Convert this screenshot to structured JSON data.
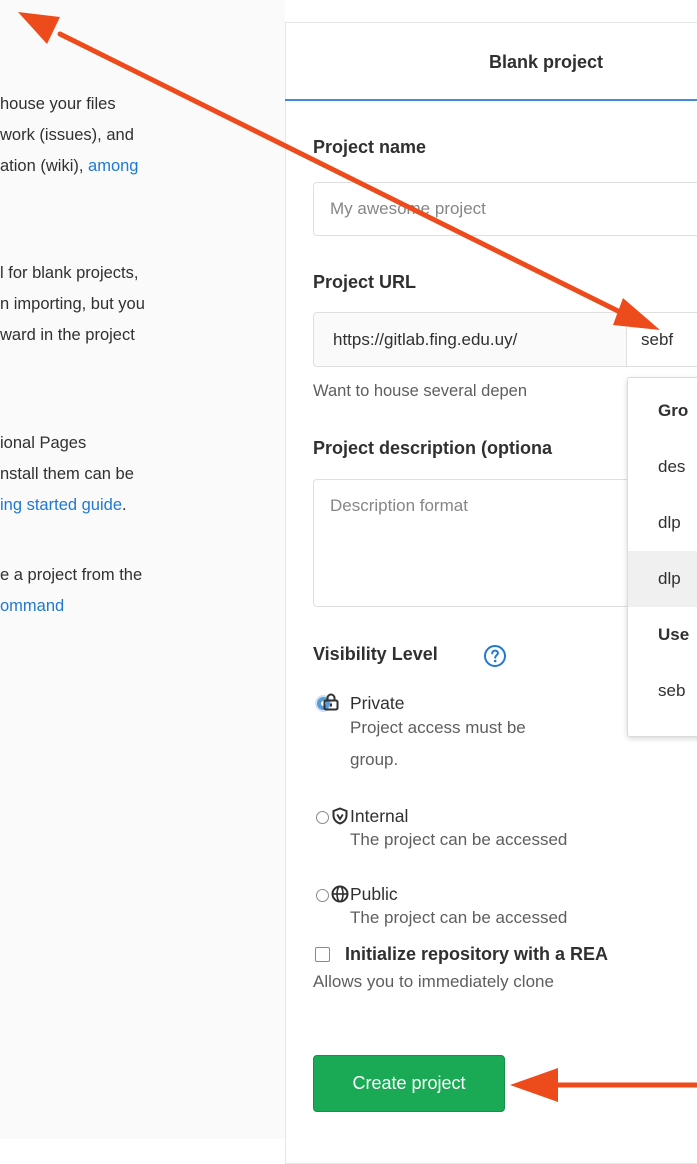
{
  "left": {
    "para1": [
      "house your files",
      "work (issues), and",
      "ation (wiki), "
    ],
    "para1_link": "among",
    "para2": [
      "l for blank projects,",
      "n importing, but you",
      "ward in the project"
    ],
    "para3_lines": [
      "ional Pages",
      "nstall them can be"
    ],
    "para3_link": "ing started guide",
    "para3_after": ".",
    "para4_line": "e a project from the",
    "para4_link": "ommand"
  },
  "tab": {
    "label": "Blank project"
  },
  "form": {
    "project_name_label": "Project name",
    "project_name_placeholder": "My awesome project",
    "project_url_label": "Project URL",
    "url_prefix": "https://gitlab.fing.edu.uy/",
    "namespace_value": "sebf",
    "namespace_help": "Want to house several depen",
    "description_label": "Project description (optiona",
    "description_placeholder": "Description format",
    "visibility_label": "Visibility Level",
    "visibility_options": [
      {
        "title": "Private",
        "desc": [
          "Project access must be",
          "group."
        ],
        "selected": true
      },
      {
        "title": "Internal",
        "desc": [
          "The project can be accessed"
        ],
        "selected": false
      },
      {
        "title": "Public",
        "desc": [
          "The project can be accessed"
        ],
        "selected": false
      }
    ],
    "readme_label": "Initialize repository with a REA",
    "readme_desc": "Allows you to immediately clone",
    "readme_checked": false,
    "create_button": "Create project"
  },
  "namespace_dropdown": {
    "items": [
      {
        "text": "Gro",
        "kind": "header"
      },
      {
        "text": "des",
        "kind": "option"
      },
      {
        "text": "dlp",
        "kind": "option"
      },
      {
        "text": "dlp",
        "kind": "option",
        "active": true
      },
      {
        "text": "Use",
        "kind": "header"
      },
      {
        "text": "seb",
        "kind": "option"
      }
    ]
  },
  "colors": {
    "primary_button": "#1aaa55",
    "link": "#1f78d1",
    "annotation_arrow": "#ee4b1d"
  },
  "icons": {
    "help": "question-circle-icon",
    "private": "lock-icon",
    "internal": "shield-icon",
    "public": "globe-icon"
  }
}
